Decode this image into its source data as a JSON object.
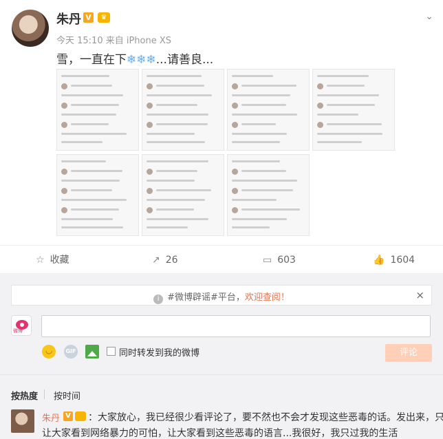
{
  "post": {
    "author": "朱丹",
    "verified_badge": "V",
    "meta": "今天 15:10 来自 iPhone XS",
    "content_prefix": "雪，一直在下",
    "content_snow": "❄❄❄",
    "content_suffix": "...请善良...",
    "menu_icon": "chevron-down-icon"
  },
  "actions": {
    "favorite_label": "收藏",
    "repost_count": "26",
    "comment_count": "603",
    "like_count": "1604"
  },
  "notice": {
    "prefix": "#微博辟谣#平台，",
    "highlight": "欢迎查阅！",
    "close": "×"
  },
  "composer": {
    "input_value": "",
    "gif_label": "GIF",
    "forward_label": "同时转发到我的微博",
    "submit_label": "评论",
    "avatar_label": "微博"
  },
  "sort": {
    "hot": "按热度",
    "time": "按时间"
  },
  "comment": {
    "author": "朱丹",
    "badge": "V",
    "line1": "：大家放心，我已经很少看评论了，要不然也不会才发现这些恶毒的话。发出来，只是",
    "line2": "让大家看到网络暴力的可怕，让大家看到这些恶毒的语言...我很好，我只过我的生活"
  },
  "colors": {
    "accent": "#eb7350",
    "verified": "#f5a623",
    "submit_disabled": "#ffcfb8"
  }
}
